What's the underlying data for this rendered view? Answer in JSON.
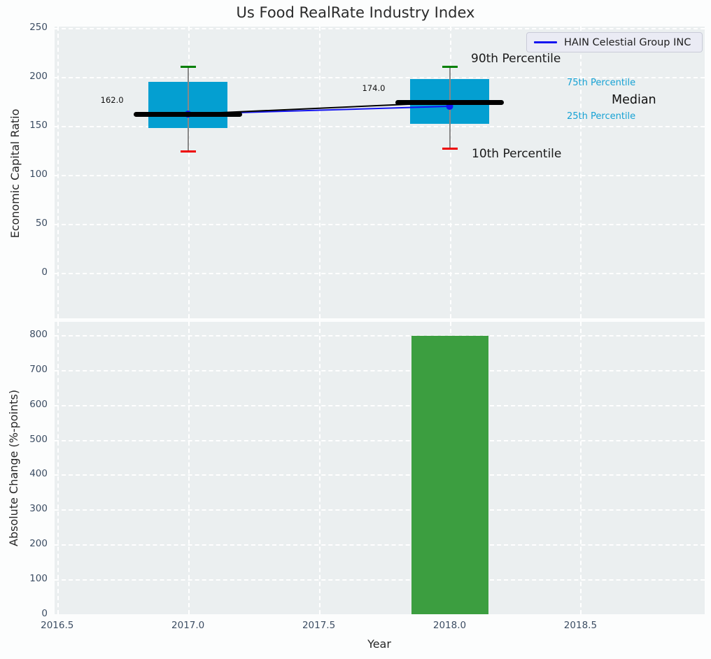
{
  "figure": {
    "title": "Us Food RealRate Industry Index",
    "background": "#fcfdfd",
    "axes_background": "#ebeff0"
  },
  "colors": {
    "box_fill": "#049fd1",
    "bar_fill": "#3c9e40",
    "p90_cap": "#008000",
    "p10_cap": "#ee0000",
    "whisker": "#888888",
    "median_line": "#000000",
    "company_line": "#1414f0",
    "grid": "#ffffff",
    "tick_text": "#3c4d63",
    "cyan_text": "#17a2d4",
    "dark_text": "#1a1a1a"
  },
  "chart_data": [
    {
      "type": "box",
      "title": "Us Food RealRate Industry Index",
      "ylabel": "Economic Capital Ratio",
      "ylim": [
        -46.5,
        251.4
      ],
      "yticks": [
        0,
        50,
        100,
        150,
        200,
        250
      ],
      "xlim": [
        2016.49,
        2018.975
      ],
      "xticks": [
        2016.5,
        2017.0,
        2017.5,
        2018.0,
        2018.5
      ],
      "xtick_labels": [
        "2016.5",
        "2017.0",
        "2017.5",
        "2018.0",
        "2018.5"
      ],
      "grid": true,
      "legend_label": "HAIN Celestial Group INC",
      "legend_position": "upper right",
      "boxes": [
        {
          "year": 2017,
          "p10": 124,
          "p25": 148,
          "median": 162,
          "p75": 195,
          "p90": 210,
          "annotation": "162.0"
        },
        {
          "year": 2018,
          "p10": 127,
          "p25": 152,
          "median": 174,
          "p75": 198,
          "p90": 210,
          "annotation": "174.0"
        }
      ],
      "series": [
        {
          "name": "Median",
          "x": [
            2017,
            2018
          ],
          "values": [
            162,
            174
          ]
        },
        {
          "name": "HAIN Celestial Group INC",
          "x": [
            2017,
            2018
          ],
          "values": [
            162,
            170
          ]
        }
      ],
      "percentile_labels": [
        "90th Percentile",
        "75th Percentile",
        "Median",
        "25th Percentile",
        "10th Percentile"
      ]
    },
    {
      "type": "bar",
      "ylabel": "Absolute Change (%-points)",
      "xlabel": "Year",
      "ylim": [
        0,
        838
      ],
      "yticks": [
        0,
        100,
        200,
        300,
        400,
        500,
        600,
        700,
        800
      ],
      "xlim": [
        2016.49,
        2018.975
      ],
      "xticks": [
        2016.5,
        2017.0,
        2017.5,
        2018.0,
        2018.5
      ],
      "xtick_labels": [
        "2016.5",
        "2017.0",
        "2017.5",
        "2018.0",
        "2018.5"
      ],
      "grid": true,
      "bars": [
        {
          "year": 2018,
          "value": 797
        }
      ]
    }
  ]
}
